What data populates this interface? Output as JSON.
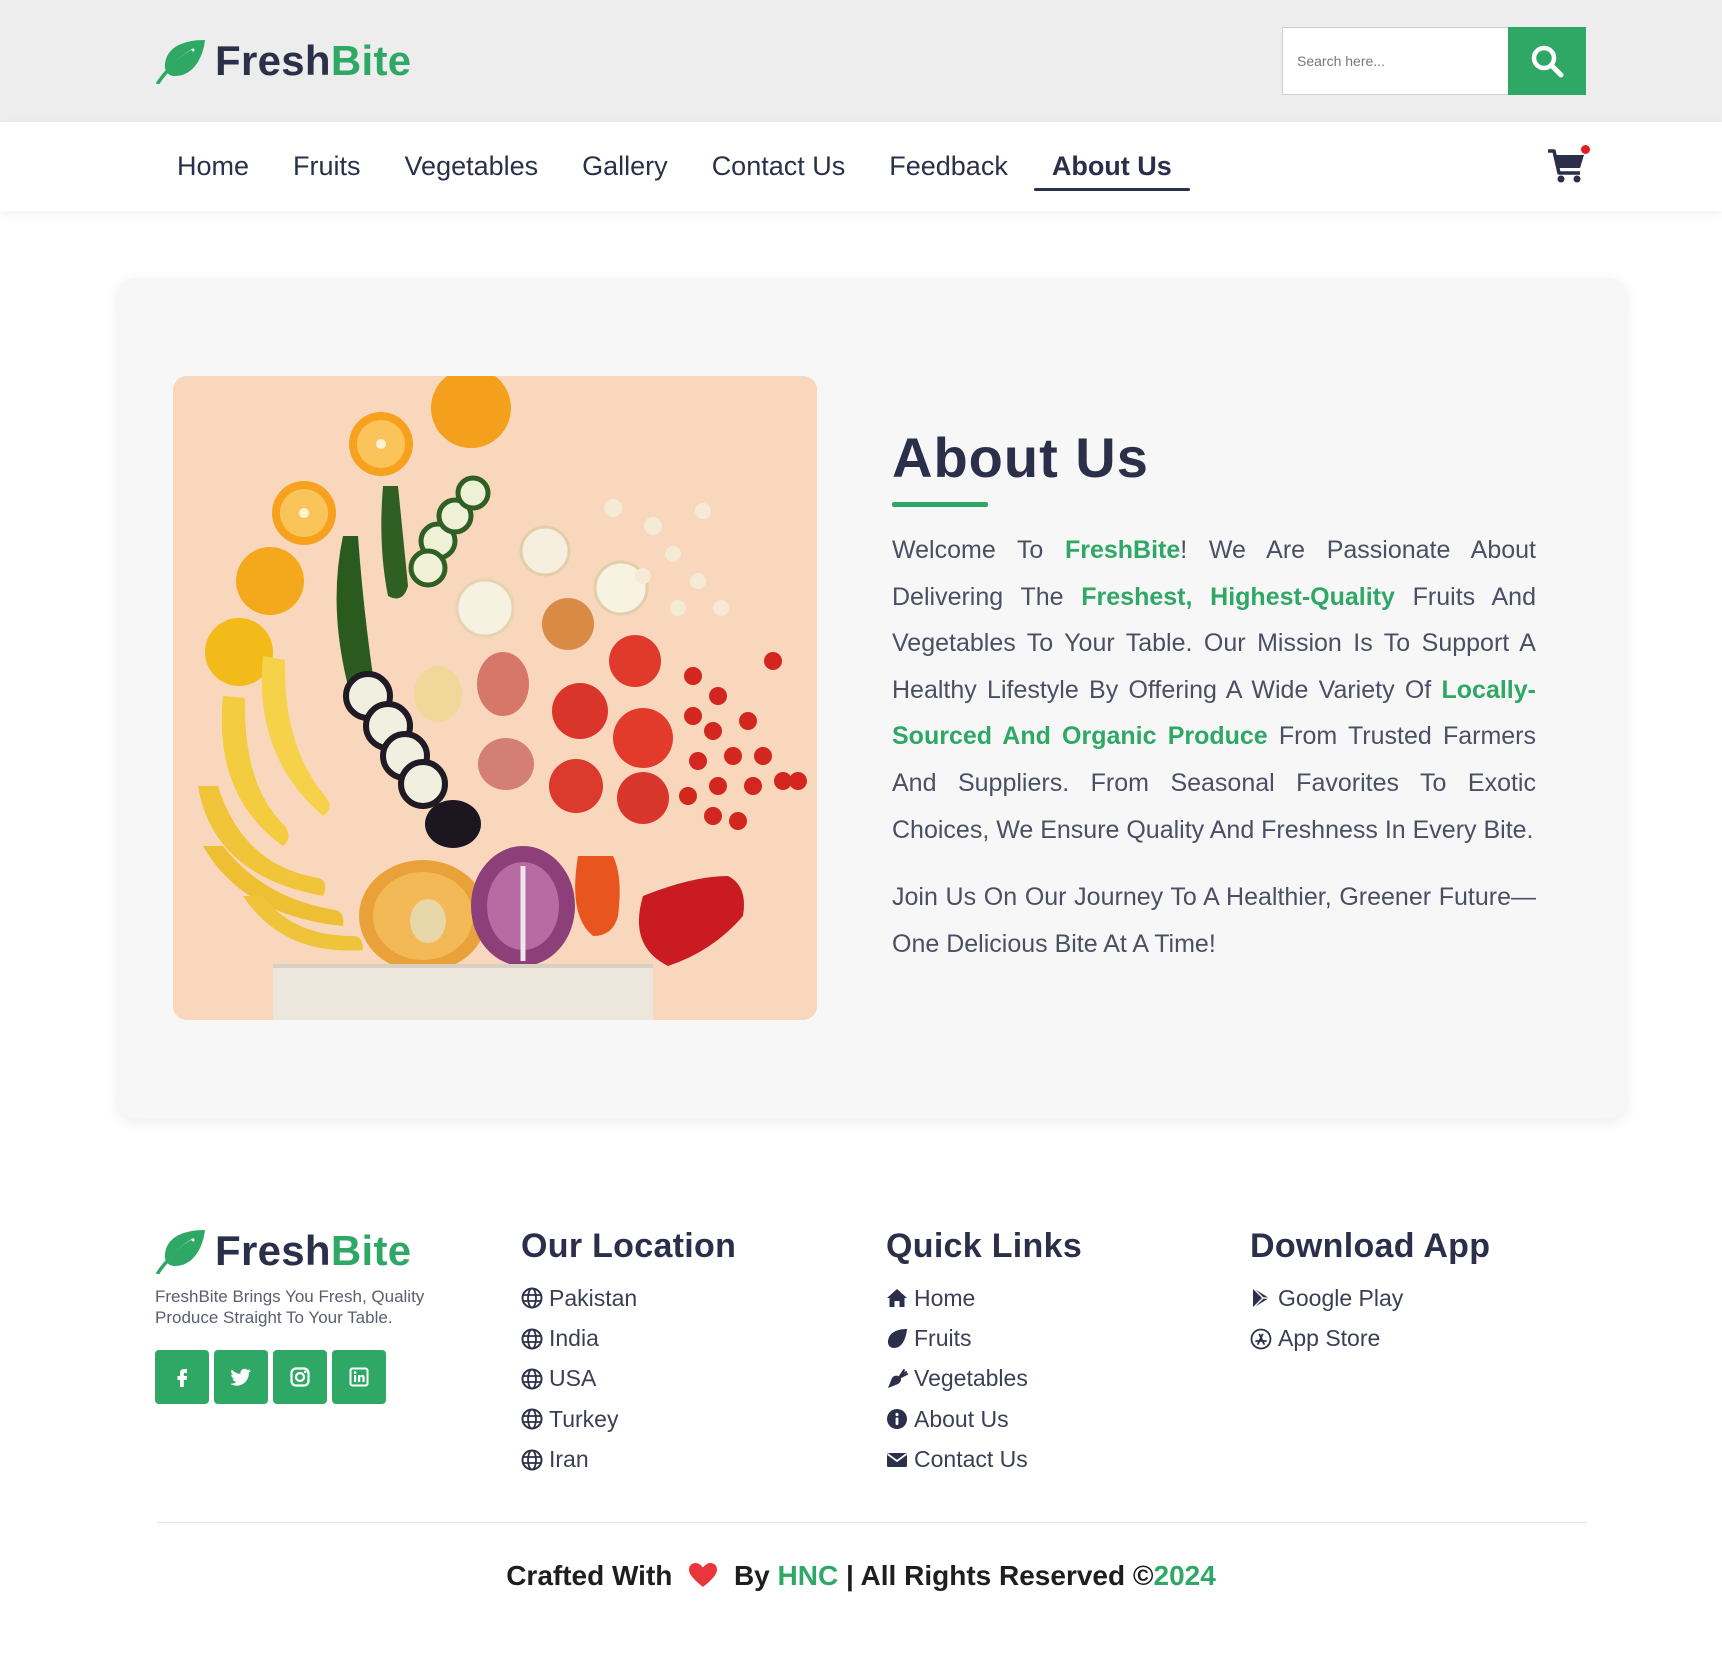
{
  "brand": {
    "part1": "Fresh",
    "part2": "Bite",
    "accent_color": "#2fa866",
    "dark_color": "#2b2f4a"
  },
  "search": {
    "placeholder": "Search here...",
    "icon": "search-icon"
  },
  "nav": {
    "items": [
      "Home",
      "Fruits",
      "Vegetables",
      "Gallery",
      "Contact Us",
      "Feedback",
      "About Us"
    ],
    "active": "About Us"
  },
  "cart": {
    "icon": "shopping-cart-icon",
    "badge_color": "#e01e1e"
  },
  "about": {
    "title": "About Us",
    "p1": {
      "t1": "Welcome To ",
      "h1": "FreshBite",
      "t2": "! We Are Passionate About Delivering The ",
      "h2": "Freshest, Highest-Quality",
      "t3": " Fruits And Vegetables To Your Table. Our Mission Is To Support A Healthy Lifestyle By Offering A Wide Variety Of ",
      "h3": "Locally-Sourced And Organic Produce",
      "t4": " From Trusted Farmers And Suppliers. From Seasonal Favorites To Exotic Choices, We Ensure Quality And Freshness In Every Bite."
    },
    "p2": "Join Us On Our Journey To A Healthier, Greener Future—One Delicious Bite At A Time!"
  },
  "footer": {
    "tagline": "FreshBite Brings You Fresh, Quality Produce Straight To Your Table.",
    "socials": [
      "facebook-icon",
      "twitter-icon",
      "instagram-icon",
      "linkedin-icon"
    ],
    "location": {
      "title": "Our Location",
      "items": [
        "Pakistan",
        "India",
        "USA",
        "Turkey",
        "Iran"
      ]
    },
    "quick_links": {
      "title": "Quick Links",
      "items": [
        "Home",
        "Fruits",
        "Vegetables",
        "About Us",
        "Contact Us"
      ]
    },
    "download": {
      "title": "Download App",
      "items": [
        "Google Play",
        "App Store"
      ]
    },
    "copyright": {
      "t1": "Crafted With",
      "t2": "By",
      "author": "HNC",
      "t3": "| All Rights Reserved ©",
      "year": "2024"
    }
  }
}
